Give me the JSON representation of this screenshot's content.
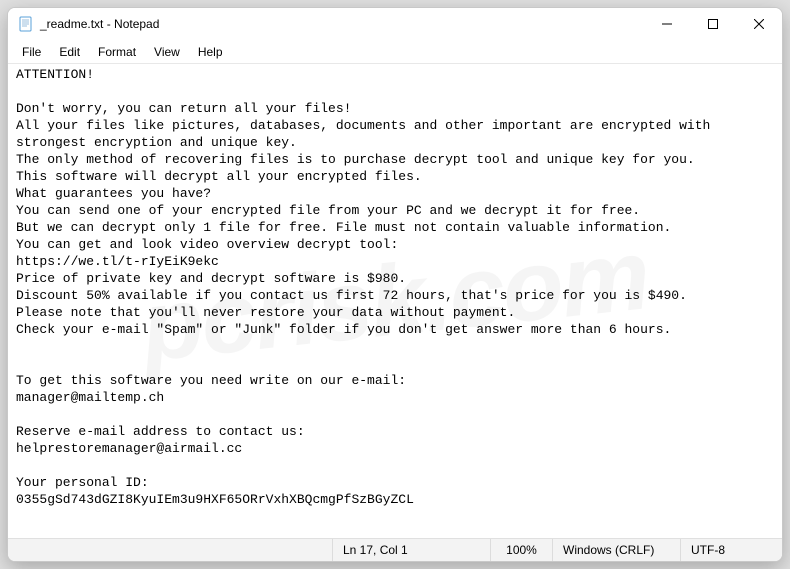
{
  "window": {
    "title": "_readme.txt - Notepad"
  },
  "menu": {
    "file": "File",
    "edit": "Edit",
    "format": "Format",
    "view": "View",
    "help": "Help"
  },
  "content": {
    "text": "ATTENTION!\n\nDon't worry, you can return all your files!\nAll your files like pictures, databases, documents and other important are encrypted with strongest encryption and unique key.\nThe only method of recovering files is to purchase decrypt tool and unique key for you.\nThis software will decrypt all your encrypted files.\nWhat guarantees you have?\nYou can send one of your encrypted file from your PC and we decrypt it for free.\nBut we can decrypt only 1 file for free. File must not contain valuable information.\nYou can get and look video overview decrypt tool:\nhttps://we.tl/t-rIyEiK9ekc\nPrice of private key and decrypt software is $980.\nDiscount 50% available if you contact us first 72 hours, that's price for you is $490.\nPlease note that you'll never restore your data without payment.\nCheck your e-mail \"Spam\" or \"Junk\" folder if you don't get answer more than 6 hours.\n\n\nTo get this software you need write on our e-mail:\nmanager@mailtemp.ch\n\nReserve e-mail address to contact us:\nhelprestoremanager@airmail.cc\n\nYour personal ID:\n0355gSd743dGZI8KyuIEm3u9HXF65ORrVxhXBQcmgPfSzBGyZCL"
  },
  "statusbar": {
    "position": "Ln 17, Col 1",
    "zoom": "100%",
    "lineending": "Windows (CRLF)",
    "encoding": "UTF-8"
  },
  "watermark": "pcrisk.com"
}
